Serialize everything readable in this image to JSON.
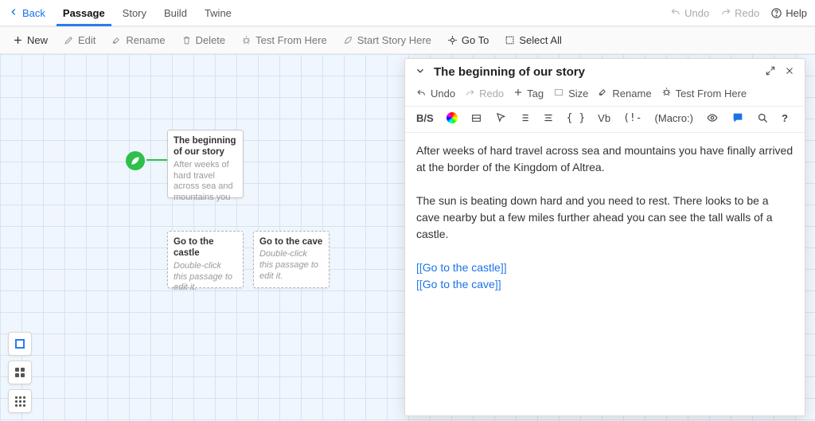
{
  "topbar": {
    "back": "Back",
    "tabs": [
      "Passage",
      "Story",
      "Build",
      "Twine"
    ],
    "active_tab": 0,
    "undo": "Undo",
    "redo": "Redo",
    "help": "Help"
  },
  "toolbar": {
    "new": "New",
    "edit": "Edit",
    "rename": "Rename",
    "delete": "Delete",
    "test_from_here": "Test From Here",
    "start_story_here": "Start Story Here",
    "go_to": "Go To",
    "select_all": "Select All"
  },
  "nodes": {
    "start": {
      "title": "The beginning of our story",
      "body": "After weeks of hard travel across sea and mountains you"
    },
    "castle": {
      "title": "Go to the castle",
      "body": "Double-click this passage to edit it."
    },
    "cave": {
      "title": "Go to the cave",
      "body": "Double-click this passage to edit it."
    }
  },
  "editor": {
    "title": "The beginning of our story",
    "toolbar": {
      "undo": "Undo",
      "redo": "Redo",
      "tag": "Tag",
      "size": "Size",
      "rename": "Rename",
      "test_from_here": "Test From Here"
    },
    "fmt": {
      "bs": "B/S",
      "vb": "Vb",
      "macro": "(Macro:)"
    },
    "paragraph1": "After weeks of hard travel across sea and mountains you have finally arrived at the border of the Kingdom of Altrea.",
    "paragraph2": "The sun is beating down hard and you need to rest.  There looks to be a cave nearby but a few miles further ahead you can see the tall walls of a castle.",
    "link1_open": "[[",
    "link1_text": "Go to the castle",
    "link1_close": "]]",
    "link2_open": "[[",
    "link2_text": "Go to the cave",
    "link2_close": "]]"
  }
}
